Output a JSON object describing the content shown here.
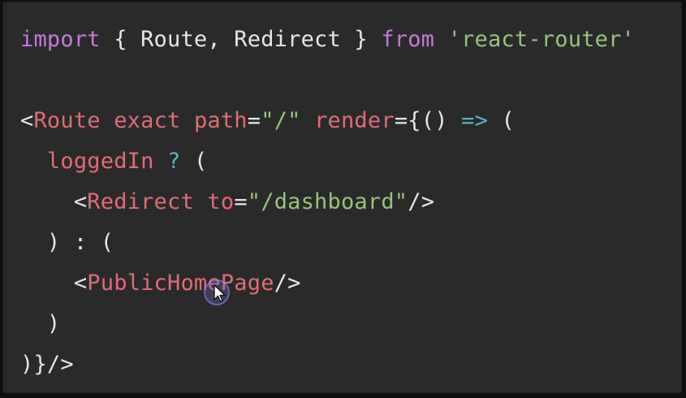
{
  "code": {
    "line1": {
      "import_kw": "import",
      "braces_content": " { Route, Redirect } ",
      "from_kw": "from",
      "space": " ",
      "module": "'react-router'"
    },
    "line3": {
      "lt": "<",
      "tag": "Route",
      "attr1": " exact path",
      "eq1": "=",
      "val1": "\"/\"",
      "attr2": " render",
      "eq2": "=",
      "brace": "{() ",
      "arrow": "=>",
      "paren": " ("
    },
    "line4": {
      "indent": "  ",
      "ident": "loggedIn",
      "q": " ?",
      "paren": " ("
    },
    "line5": {
      "indent": "    <",
      "tag": "Redirect",
      "attr": " to",
      "eq": "=",
      "val": "\"/dashboard\"",
      "close": "/>"
    },
    "line6": {
      "text": "  ) : ("
    },
    "line7": {
      "indent": "    <",
      "tag": "PublicHomePage",
      "close": "/>"
    },
    "line8": {
      "text": "  )"
    },
    "line9": {
      "text": ")}/>"
    }
  },
  "colors": {
    "background": "#2a2a2b",
    "keyword": "#c678dd",
    "string": "#98c379",
    "tag": "#e06c75",
    "operator": "#56b6c2",
    "text": "#e6e6e6"
  },
  "icons": {
    "cursor": "mouse-pointer-icon"
  }
}
